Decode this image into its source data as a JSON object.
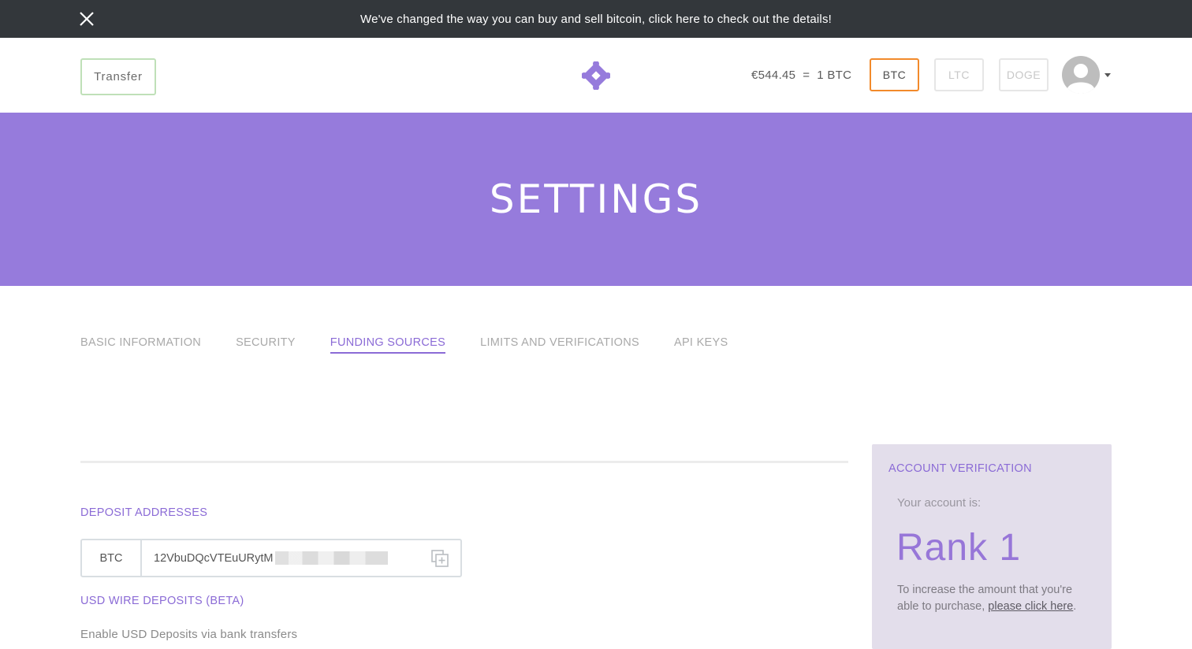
{
  "announcement": {
    "text": "We've changed the way you can buy and sell bitcoin, click here to check out the details!",
    "close_icon": "close-icon"
  },
  "header": {
    "transfer_label": "Transfer",
    "logo_icon": "diamond-logo-icon",
    "price_text": "€544.45  =  1 BTC",
    "currencies": [
      {
        "label": "BTC",
        "active": true
      },
      {
        "label": "LTC",
        "active": false
      },
      {
        "label": "DOGE",
        "active": false
      }
    ],
    "avatar_icon": "user-avatar-icon"
  },
  "hero": {
    "title": "SETTINGS"
  },
  "tabs": [
    {
      "label": "BASIC INFORMATION",
      "active": false
    },
    {
      "label": "SECURITY",
      "active": false
    },
    {
      "label": "FUNDING SOURCES",
      "active": true
    },
    {
      "label": "LIMITS AND VERIFICATIONS",
      "active": false
    },
    {
      "label": "API KEYS",
      "active": false
    }
  ],
  "deposit": {
    "heading": "DEPOSIT ADDRESSES",
    "currency": "BTC",
    "address_visible": "12VbuDQcVTEuURytM",
    "copy_icon": "copy-icon"
  },
  "usd_wire": {
    "heading": "USD WIRE DEPOSITS (BETA)",
    "text": "Enable USD Deposits via bank transfers"
  },
  "verification": {
    "title": "ACCOUNT VERIFICATION",
    "subtitle": "Your account is:",
    "rank": "Rank 1",
    "desc_prefix": "To increase the amount that you're able to purchase, ",
    "link_text": "please click here",
    "desc_suffix": "."
  },
  "colors": {
    "accent_purple": "#967bdc",
    "active_orange": "#f28a2b",
    "announce_bg": "#33373b"
  }
}
